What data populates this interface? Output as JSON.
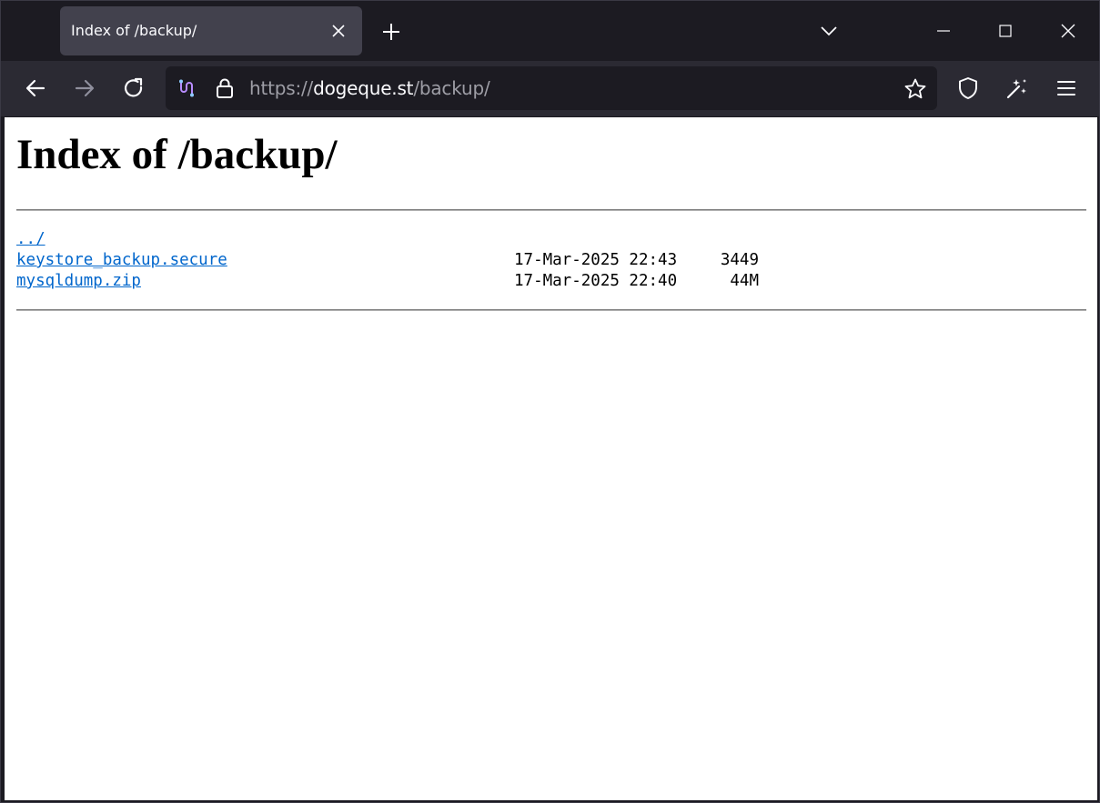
{
  "tab": {
    "title": "Index of /backup/"
  },
  "url": {
    "scheme": "https://",
    "host": "dogeque.st",
    "path": "/backup/"
  },
  "page": {
    "heading": "Index of /backup/",
    "entries": [
      {
        "name": "../",
        "date": "",
        "size": ""
      },
      {
        "name": "keystore_backup.secure",
        "date": "17-Mar-2025 22:43",
        "size": "3449"
      },
      {
        "name": "mysqldump.zip",
        "date": "17-Mar-2025 22:40",
        "size": "44M"
      }
    ]
  },
  "icons": {
    "tab_close": "close-icon",
    "new_tab": "plus-icon",
    "tab_list": "chevron-down-icon",
    "back": "arrow-left-icon",
    "forward": "arrow-right-icon",
    "reload": "reload-icon",
    "extension": "extension-icon",
    "lock": "lock-icon",
    "bookmark": "star-icon",
    "shield": "shield-icon",
    "magic": "magic-wand-icon",
    "menu": "hamburger-menu-icon"
  },
  "colors": {
    "link": "#0066cc",
    "chrome_dark": "#1c1b22",
    "toolbar": "#2b2a33",
    "tab_active": "#42414d"
  }
}
